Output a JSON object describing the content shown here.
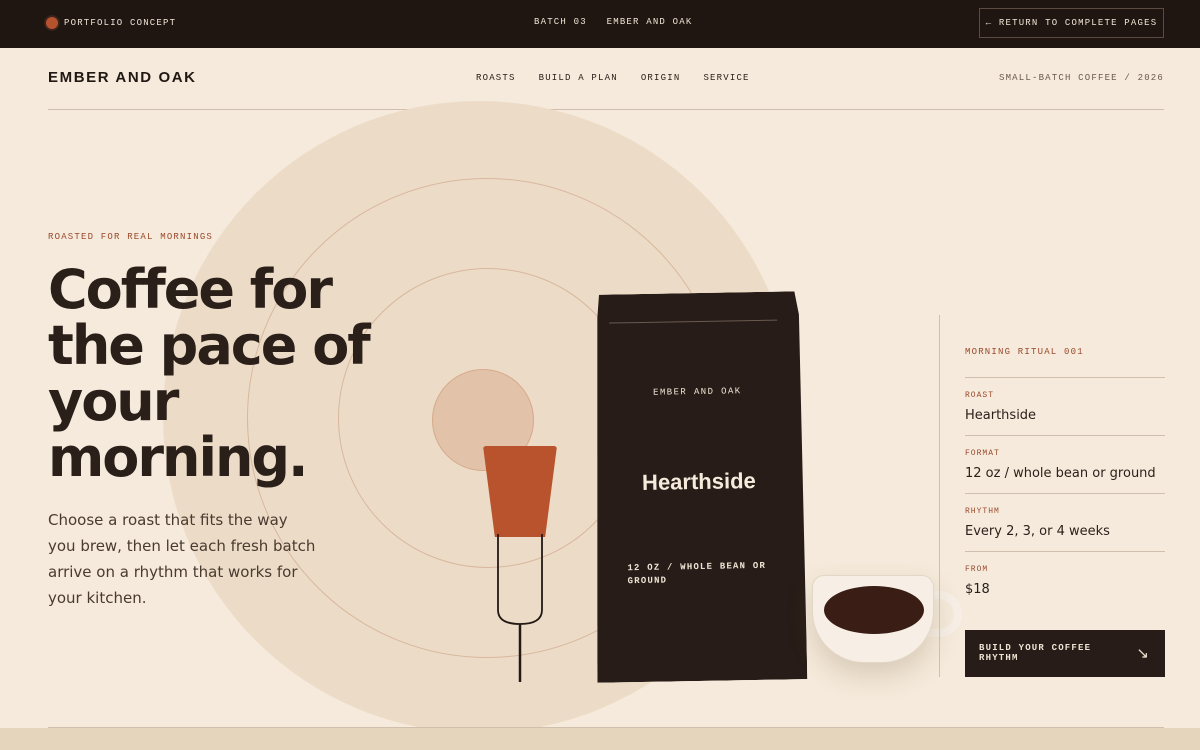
{
  "topbar": {
    "brand_label": "PORTFOLIO CONCEPT",
    "batch": "BATCH 03",
    "batch_name": "EMBER AND OAK",
    "return_label": "← RETURN TO COMPLETE PAGES"
  },
  "header": {
    "logo": "EMBER AND OAK",
    "nav": [
      "ROASTS",
      "BUILD A PLAN",
      "ORIGIN",
      "SERVICE"
    ],
    "tagline": "SMALL-BATCH COFFEE / 2026"
  },
  "hero": {
    "eyebrow": "ROASTED FOR REAL MORNINGS",
    "headline": [
      "Coffee for",
      "the pace of",
      "your",
      "morning."
    ],
    "lede": "Choose a roast that fits the way you brew, then let each fresh batch arrive on a rhythm that works for your kitchen."
  },
  "bag": {
    "brand": "EMBER AND OAK",
    "product": "Hearthside",
    "spec": "12 OZ / WHOLE BEAN OR GROUND"
  },
  "panel": {
    "title": "MORNING RITUAL 001",
    "rows": [
      {
        "label": "ROAST",
        "value": "Hearthside"
      },
      {
        "label": "FORMAT",
        "value": "12 oz / whole bean or ground"
      },
      {
        "label": "RHYTHM",
        "value": "Every 2, 3, or 4 weeks"
      },
      {
        "label": "FROM",
        "value": "$18"
      }
    ],
    "cta_label": "BUILD YOUR COFFEE RHYTHM",
    "cta_arrow": "↘"
  },
  "colors": {
    "background": "#f5eadb",
    "dark": "#1f1612",
    "accent": "#b9532d",
    "circle": "#ecdcc7"
  }
}
